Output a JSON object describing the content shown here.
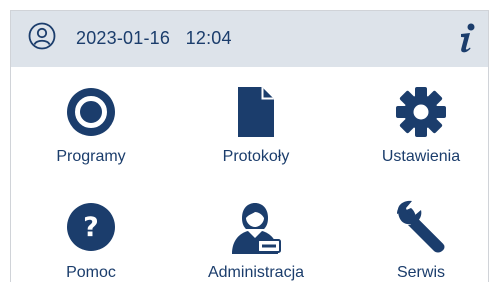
{
  "header": {
    "datetime": "2023-01-16   12:04",
    "user_icon": "user-circle-icon",
    "info_icon": "info-icon"
  },
  "menu": [
    {
      "label": "Programy",
      "icon": "program-circle-icon"
    },
    {
      "label": "Protokoły",
      "icon": "document-icon"
    },
    {
      "label": "Ustawienia",
      "icon": "gear-icon"
    },
    {
      "label": "Pomoc",
      "icon": "help-icon"
    },
    {
      "label": "Administracja",
      "icon": "admin-user-icon"
    },
    {
      "label": "Serwis",
      "icon": "wrench-icon"
    }
  ],
  "colors": {
    "accent": "#1b3d6c",
    "header_bg": "#dde3ea"
  }
}
